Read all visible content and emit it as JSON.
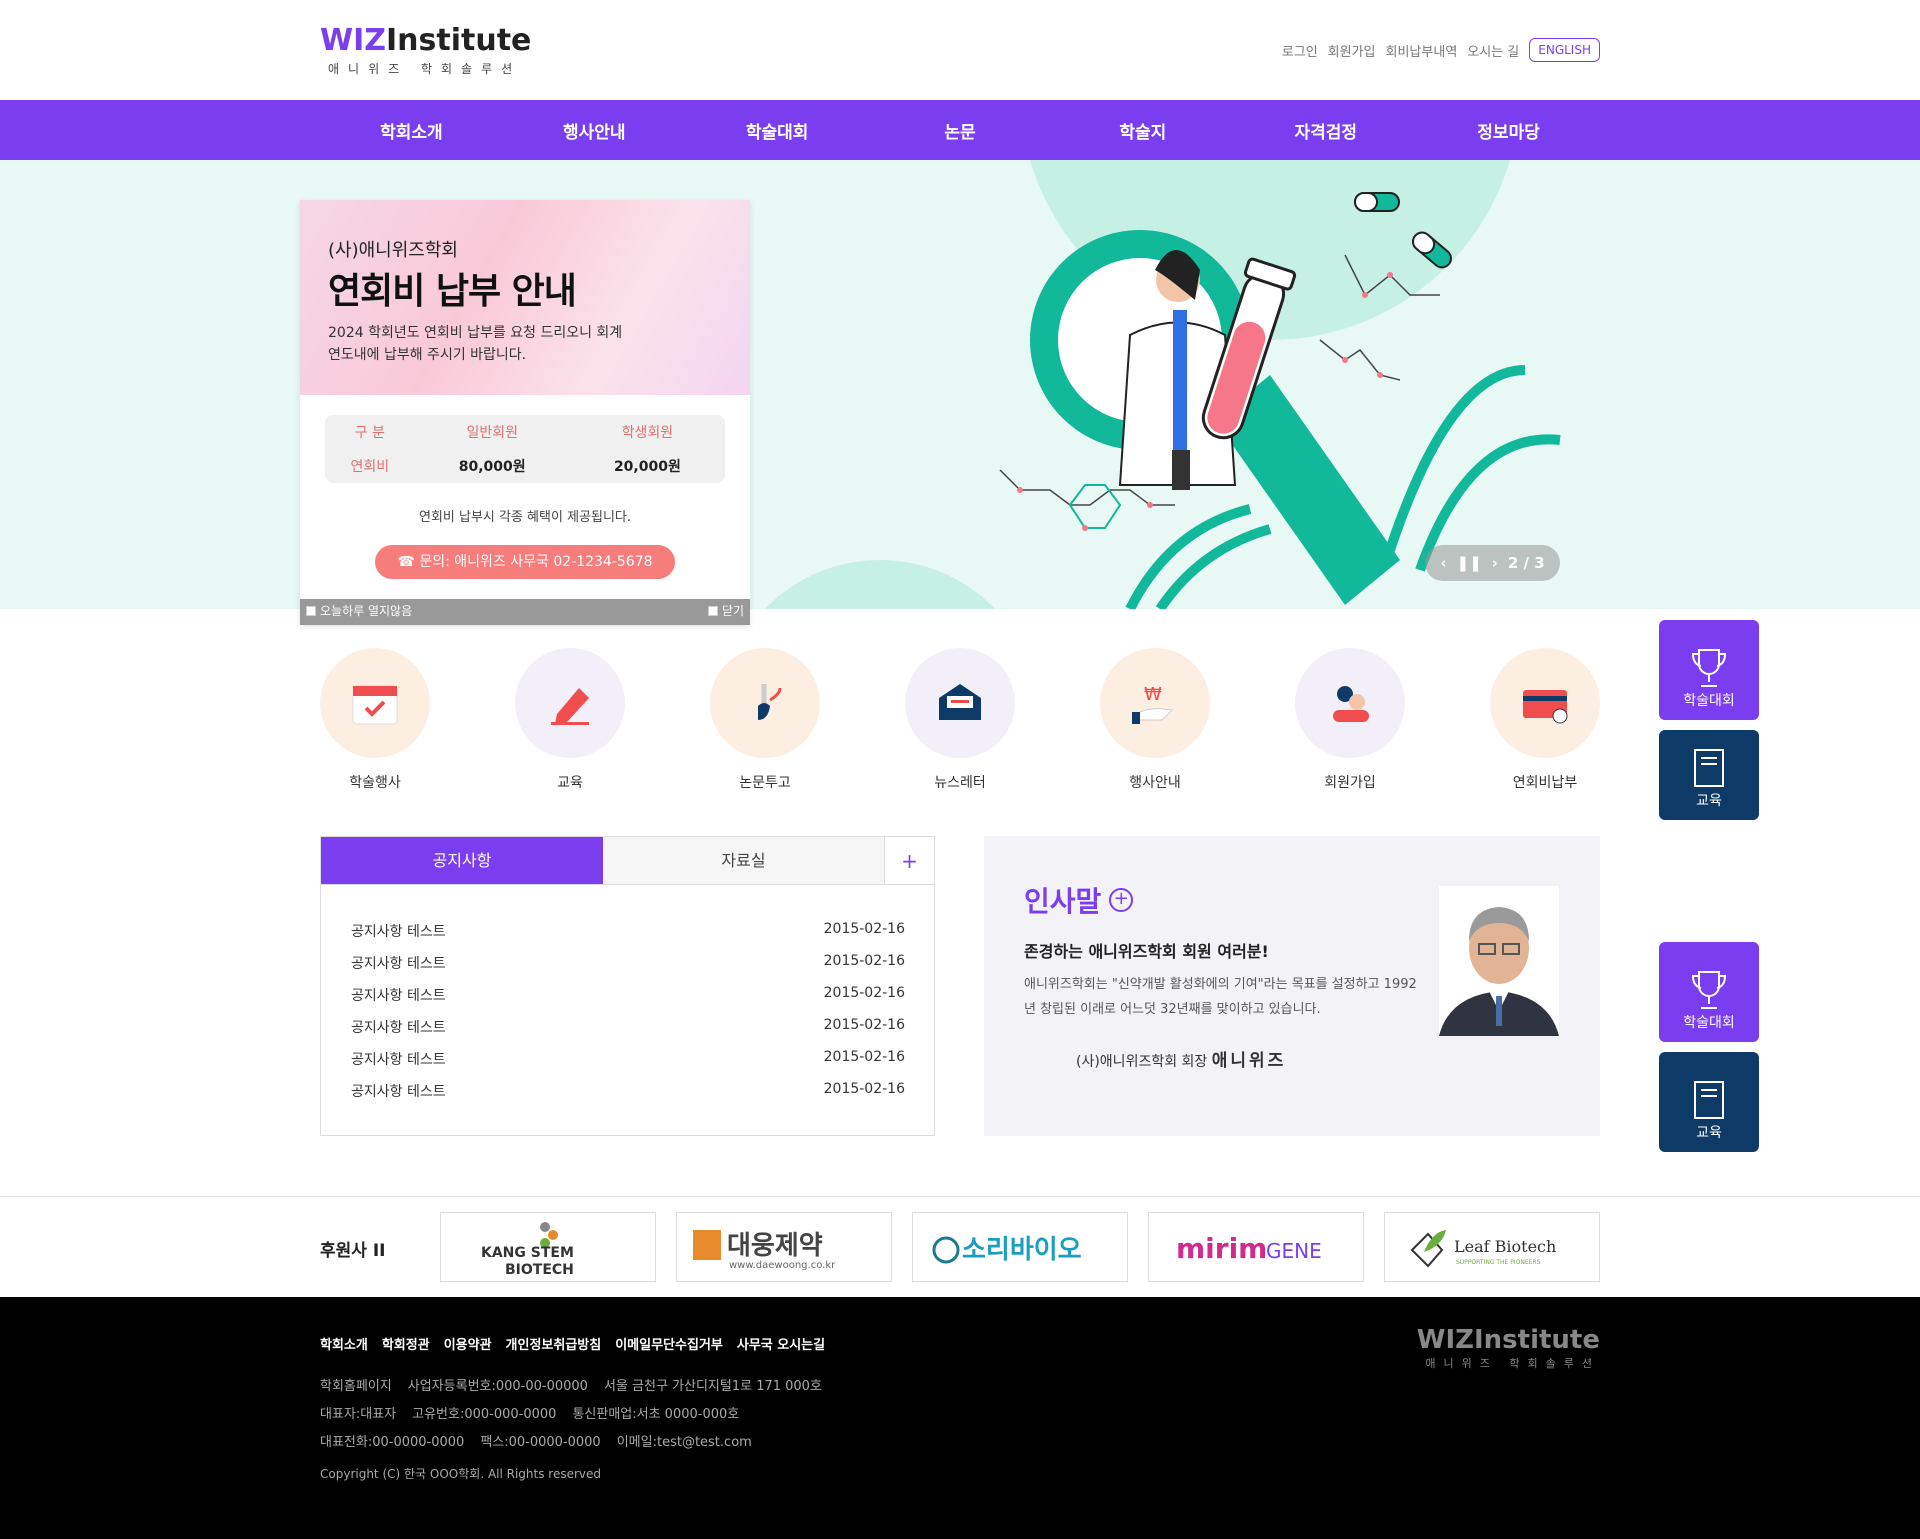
{
  "brand": {
    "logo_main": "WIZInstitute",
    "logo_wiz": "WIZ",
    "logo_rest": "Institute",
    "logo_sub": "애니위즈 학회솔루션"
  },
  "util": {
    "login": "로그인",
    "join": "회원가입",
    "fee": "회비납부내역",
    "map": "오시는 길",
    "english": "ENGLISH"
  },
  "gnb": [
    "학회소개",
    "행사안내",
    "학술대회",
    "논문",
    "학술지",
    "자격검정",
    "정보마당"
  ],
  "popup": {
    "sub": "(사)애니위즈학회",
    "title": "연회비 납부 안내",
    "desc": "2024 학회년도 연회비 납부를 요청 드리오니 회계연도내에 납부해 주시기 바랍니다.",
    "table": {
      "h0": "구  분",
      "h1": "일반회원",
      "h2": "학생회원",
      "r0": "연회비",
      "r1": "80,000원",
      "r2": "20,000원"
    },
    "note": "연회비 납부시 각종 혜택이 제공됩니다.",
    "contact": "문의: 애니위즈 사무국 02-1234-5678",
    "today": "오늘하루 열지않음",
    "close": "닫기"
  },
  "slider": {
    "current": "2",
    "sep": "/",
    "total": "3"
  },
  "quick": {
    "conf": "학술대회",
    "edu": "교육"
  },
  "icons": [
    {
      "label": "학술행사",
      "icon": "calendar-check-icon"
    },
    {
      "label": "교육",
      "icon": "pencil-icon"
    },
    {
      "label": "논문투고",
      "icon": "brush-icon"
    },
    {
      "label": "뉴스레터",
      "icon": "envelope-icon"
    },
    {
      "label": "행사안내",
      "icon": "hand-coin-icon"
    },
    {
      "label": "회원가입",
      "icon": "members-icon"
    },
    {
      "label": "연회비납부",
      "icon": "card-icon"
    }
  ],
  "notice": {
    "tab1": "공지사항",
    "tab2": "자료실",
    "more": "+",
    "items": [
      {
        "title": "공지사항 테스트",
        "date": "2015-02-16"
      },
      {
        "title": "공지사항 테스트",
        "date": "2015-02-16"
      },
      {
        "title": "공지사항 테스트",
        "date": "2015-02-16"
      },
      {
        "title": "공지사항 테스트",
        "date": "2015-02-16"
      },
      {
        "title": "공지사항 테스트",
        "date": "2015-02-16"
      },
      {
        "title": "공지사항 테스트",
        "date": "2015-02-16"
      }
    ]
  },
  "greeting": {
    "title": "인사말",
    "head": "존경하는 애니위즈학회 회원 여러분!",
    "body": "애니위즈학회는 \"신약개발 활성화에의 기여\"라는 목표를 설정하고 1992년 창립된 이래로 어느덧 32년째를 맞이하고 있습니다.",
    "sign_pre": "(사)애니위즈학회 회장",
    "sign_name": "애니위즈"
  },
  "sponsors": {
    "label": "후원사 II",
    "logos": [
      "KANG STEM BIOTECH",
      "대웅제약",
      "www.daewoong.co.kr",
      "소리바이오",
      "mirimGENE",
      "Leaf Biotech",
      "SUPPORTING THE PIONEERS"
    ]
  },
  "footer": {
    "links": [
      "학회소개",
      "학회정관",
      "이용약관",
      "개인정보취급방침",
      "이메일무단수집거부",
      "사무국 오시는길"
    ],
    "line1": [
      "학회홈페이지",
      "사업자등록번호:000-00-00000",
      "서울 금천구 가산디지털1로 171 000호"
    ],
    "line2": [
      "대표자:대표자",
      "고유번호:000-000-0000",
      "통신판매업:서초 0000-000호"
    ],
    "line3": [
      "대표전화:00-0000-0000",
      "팩스:00-0000-0000",
      "이메일:test@test.com"
    ],
    "copyright": "Copyright (C) 한국 OOO학회. All Rights reserved"
  },
  "colors": {
    "accent": "#7b3df0",
    "navy": "#0d3a66",
    "mint": "#12b89a",
    "coral": "#f77c7c"
  }
}
